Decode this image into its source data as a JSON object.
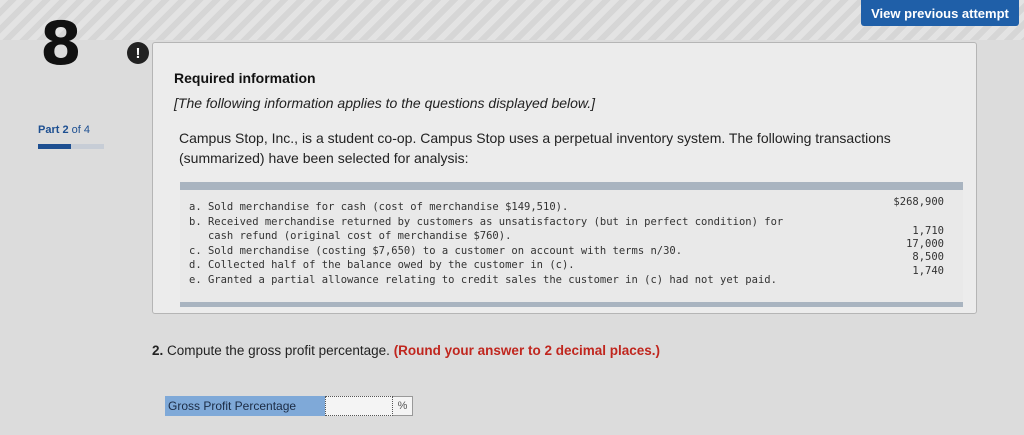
{
  "header": {
    "view_previous_label": "View previous attempt",
    "question_number": "8",
    "alert_symbol": "!"
  },
  "progress": {
    "part_word": "Part",
    "part_current": "2",
    "part_of": "of 4",
    "fraction": 0.5
  },
  "info": {
    "title": "Required information",
    "note": "[The following information applies to the questions displayed below.]",
    "intro": "Campus Stop, Inc., is a student co-op. Campus Stop uses a perpetual inventory system. The following transactions (summarized) have been selected for analysis:"
  },
  "transactions": [
    {
      "text": "a. Sold merchandise for cash (cost of merchandise $149,510)."
    },
    {
      "text": "b. Received merchandise returned by customers as unsatisfactory (but in perfect condition) for\n   cash refund (original cost of merchandise $760)."
    },
    {
      "text": "c. Sold merchandise (costing $7,650) to a customer on account with terms n/30."
    },
    {
      "text": "d. Collected half of the balance owed by the customer in (c)."
    },
    {
      "text": "e. Granted a partial allowance relating to credit sales the customer in (c) had not yet paid."
    }
  ],
  "amounts": [
    "$268,900",
    "1,710",
    "17,000",
    "8,500",
    "1,740"
  ],
  "question": {
    "number": "2.",
    "text": "Compute the gross profit percentage.",
    "instruction": "(Round your answer to 2 decimal places.)"
  },
  "answer": {
    "label": "Gross Profit Percentage",
    "value": "",
    "unit": "%"
  },
  "colors": {
    "accent_blue": "#1f5fa8",
    "answer_label_bg": "#7fa9d8",
    "instruction_red": "#c0261e"
  }
}
